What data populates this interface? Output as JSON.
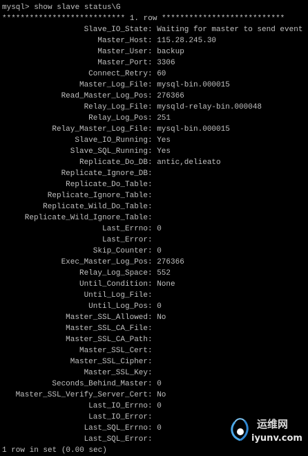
{
  "terminal": {
    "prompt": "mysql> show slave status\\G",
    "row_header": "*************************** 1. row ***************************",
    "fields": [
      {
        "key": "Slave_IO_State",
        "value": "Waiting for master to send event"
      },
      {
        "key": "Master_Host",
        "value": "115.28.245.30"
      },
      {
        "key": "Master_User",
        "value": "backup"
      },
      {
        "key": "Master_Port",
        "value": "3306"
      },
      {
        "key": "Connect_Retry",
        "value": "60"
      },
      {
        "key": "Master_Log_File",
        "value": "mysql-bin.000015"
      },
      {
        "key": "Read_Master_Log_Pos",
        "value": "276366"
      },
      {
        "key": "Relay_Log_File",
        "value": "mysqld-relay-bin.000048"
      },
      {
        "key": "Relay_Log_Pos",
        "value": "251"
      },
      {
        "key": "Relay_Master_Log_File",
        "value": "mysql-bin.000015"
      },
      {
        "key": "Slave_IO_Running",
        "value": "Yes"
      },
      {
        "key": "Slave_SQL_Running",
        "value": "Yes"
      },
      {
        "key": "Replicate_Do_DB",
        "value": "antic,delieato"
      },
      {
        "key": "Replicate_Ignore_DB",
        "value": ""
      },
      {
        "key": "Replicate_Do_Table",
        "value": ""
      },
      {
        "key": "Replicate_Ignore_Table",
        "value": ""
      },
      {
        "key": "Replicate_Wild_Do_Table",
        "value": ""
      },
      {
        "key": "Replicate_Wild_Ignore_Table",
        "value": ""
      },
      {
        "key": "Last_Errno",
        "value": "0"
      },
      {
        "key": "Last_Error",
        "value": ""
      },
      {
        "key": "Skip_Counter",
        "value": "0"
      },
      {
        "key": "Exec_Master_Log_Pos",
        "value": "276366"
      },
      {
        "key": "Relay_Log_Space",
        "value": "552"
      },
      {
        "key": "Until_Condition",
        "value": "None"
      },
      {
        "key": "Until_Log_File",
        "value": ""
      },
      {
        "key": "Until_Log_Pos",
        "value": "0"
      },
      {
        "key": "Master_SSL_Allowed",
        "value": "No"
      },
      {
        "key": "Master_SSL_CA_File",
        "value": ""
      },
      {
        "key": "Master_SSL_CA_Path",
        "value": ""
      },
      {
        "key": "Master_SSL_Cert",
        "value": ""
      },
      {
        "key": "Master_SSL_Cipher",
        "value": ""
      },
      {
        "key": "Master_SSL_Key",
        "value": ""
      },
      {
        "key": "Seconds_Behind_Master",
        "value": "0"
      },
      {
        "key": "Master_SSL_Verify_Server_Cert",
        "value": "No"
      },
      {
        "key": "Last_IO_Errno",
        "value": "0"
      },
      {
        "key": "Last_IO_Error",
        "value": ""
      },
      {
        "key": "Last_SQL_Errno",
        "value": "0"
      },
      {
        "key": "Last_SQL_Error",
        "value": ""
      }
    ],
    "footer": "1 row in set (0.00 sec)"
  },
  "watermark": {
    "site_name": "运维网",
    "url": "iyunv.com",
    "icon": "swirl-logo-icon"
  },
  "colors": {
    "background": "#000000",
    "text": "#c0c0c0"
  }
}
